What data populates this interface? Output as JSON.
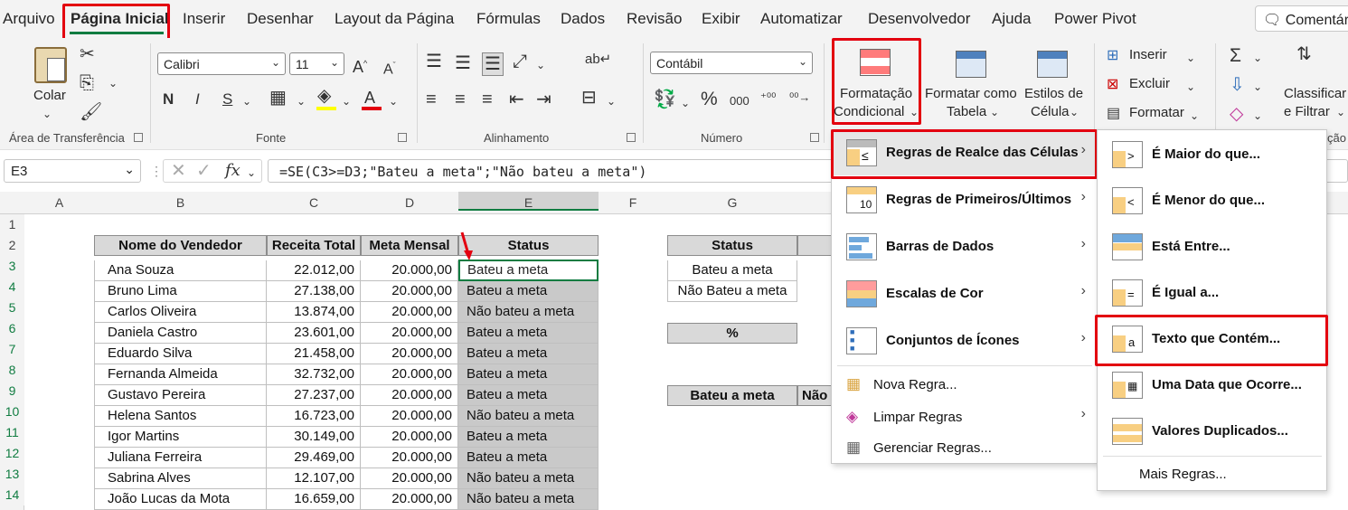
{
  "tabs": [
    "Arquivo",
    "Página Inicial",
    "Inserir",
    "Desenhar",
    "Layout da Página",
    "Fórmulas",
    "Dados",
    "Revisão",
    "Exibir",
    "Automatizar",
    "Desenvolvedor",
    "Ajuda",
    "Power Pivot"
  ],
  "comment_label": "Comentár",
  "ribbon": {
    "clipboard": {
      "paste": "Colar",
      "group": "Área de Transferência"
    },
    "font": {
      "name": "Calibri",
      "size": "11",
      "bold": "N",
      "italic": "I",
      "underline": "S",
      "group": "Fonte"
    },
    "alignment": {
      "group": "Alinhamento"
    },
    "number": {
      "format": "Contábil",
      "percent": "%",
      "thousands": "000",
      "group": "Número"
    },
    "styles": {
      "conditional_line1": "Formatação",
      "conditional_line2": "Condicional",
      "table_line1": "Formatar como",
      "table_line2": "Tabela",
      "cell_line1": "Estilos de",
      "cell_line2": "Célula"
    },
    "cells": {
      "insert": "Inserir",
      "delete": "Excluir",
      "format": "Formatar"
    },
    "editing": {
      "sort_line1": "Classificar",
      "sort_line2": "e Filtrar",
      "group_fragment": "ção"
    }
  },
  "namebox": "E3",
  "formula": "=SE(C3>=D3;\"Bateu a meta\";\"Não bateu a meta\")",
  "columns": [
    "A",
    "B",
    "C",
    "D",
    "E",
    "F",
    "G"
  ],
  "rows": [
    "1",
    "2",
    "3",
    "4",
    "5",
    "6",
    "7",
    "8",
    "9",
    "10",
    "11",
    "12",
    "13",
    "14"
  ],
  "table": {
    "headers": [
      "Nome do Vendedor",
      "Receita Total",
      "Meta Mensal",
      "Status"
    ],
    "rows": [
      [
        "Ana Souza",
        "22.012,00",
        "20.000,00",
        "Bateu a meta"
      ],
      [
        "Bruno Lima",
        "27.138,00",
        "20.000,00",
        "Bateu a meta"
      ],
      [
        "Carlos Oliveira",
        "13.874,00",
        "20.000,00",
        "Não bateu a meta"
      ],
      [
        "Daniela Castro",
        "23.601,00",
        "20.000,00",
        "Bateu a meta"
      ],
      [
        "Eduardo Silva",
        "21.458,00",
        "20.000,00",
        "Bateu a meta"
      ],
      [
        "Fernanda Almeida",
        "32.732,00",
        "20.000,00",
        "Bateu a meta"
      ],
      [
        "Gustavo Pereira",
        "27.237,00",
        "20.000,00",
        "Bateu a meta"
      ],
      [
        "Helena Santos",
        "16.723,00",
        "20.000,00",
        "Não bateu a meta"
      ],
      [
        "Igor Martins",
        "30.149,00",
        "20.000,00",
        "Bateu a meta"
      ],
      [
        "Juliana Ferreira",
        "29.469,00",
        "20.000,00",
        "Bateu a meta"
      ],
      [
        "Sabrina Alves",
        "12.107,00",
        "20.000,00",
        "Não bateu a meta"
      ],
      [
        "João Lucas da Mota",
        "16.659,00",
        "20.000,00",
        "Não bateu a meta"
      ]
    ]
  },
  "summary": {
    "status_header": "Status",
    "row1": "Bateu a meta",
    "row2": "Não Bateu a meta",
    "percent": "%",
    "bateu": "Bateu a meta",
    "nao_fragment": "Não"
  },
  "cf_menu": [
    "Regras de Realce das Células",
    "Regras de Primeiros/Últimos",
    "Barras de Dados",
    "Escalas de Cor",
    "Conjuntos de Ícones",
    "Nova Regra...",
    "Limpar Regras",
    "Gerenciar Regras..."
  ],
  "sub_menu": [
    "É Maior do que...",
    "É Menor do que...",
    "Está Entre...",
    "É Igual a...",
    "Texto que Contém...",
    "Uma Data que Ocorre...",
    "Valores Duplicados...",
    "Mais Regras..."
  ],
  "colors": {
    "accent_green": "#107c41",
    "highlight_red": "#e3000f",
    "selected_fill": "#c9c9c9"
  }
}
